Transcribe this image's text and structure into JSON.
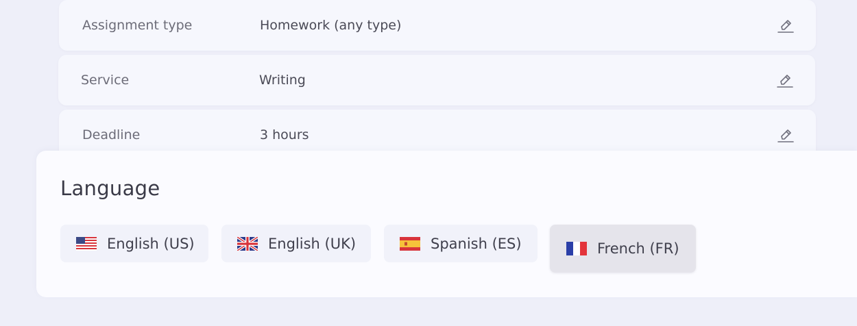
{
  "fields": [
    {
      "label": "Assignment type",
      "value": "Homework (any type)",
      "edit_icon": "edit-pencil-icon"
    },
    {
      "label": "Service",
      "value": "Writing",
      "edit_icon": "edit-pencil-icon"
    },
    {
      "label": "Deadline",
      "value": "3 hours",
      "edit_icon": "edit-pencil-icon"
    }
  ],
  "language": {
    "title": "Language",
    "selected": "French (FR)",
    "options": [
      {
        "label": "English (US)",
        "flag": "us-flag-icon"
      },
      {
        "label": "English (UK)",
        "flag": "uk-flag-icon"
      },
      {
        "label": "Spanish (ES)",
        "flag": "spain-flag-icon"
      },
      {
        "label": "French (FR)",
        "flag": "france-flag-icon"
      }
    ]
  },
  "colors": {
    "background": "#eeeff9",
    "card": "#f6f7fd",
    "selected_option": "#e5e4eb"
  }
}
